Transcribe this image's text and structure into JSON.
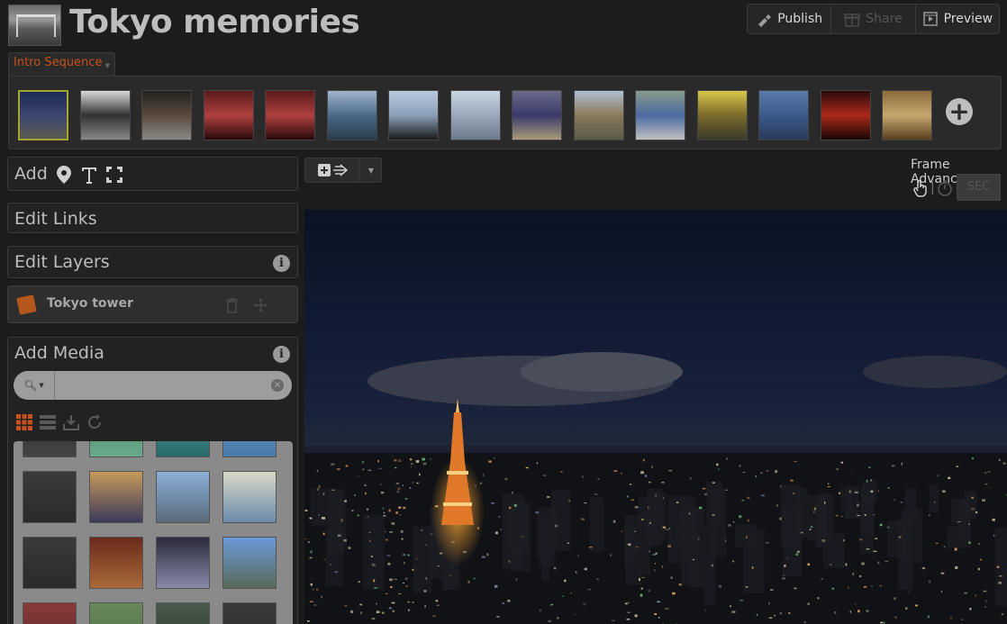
{
  "header": {
    "title": "Tokyo memories",
    "actions": [
      {
        "label": "Publish",
        "icon": "pen-icon",
        "enabled": true
      },
      {
        "label": "Share",
        "icon": "gift-icon",
        "enabled": false
      },
      {
        "label": "Preview",
        "icon": "film-icon",
        "enabled": true
      }
    ]
  },
  "sequence": {
    "tab_label": "Intro Sequence",
    "frames": [
      {
        "id": 1,
        "colors": [
          "#1c2a55",
          "#3a4570",
          "#5a5a50"
        ],
        "selected": true
      },
      {
        "id": 2,
        "colors": [
          "#d8d8d8",
          "#333333",
          "#888888"
        ],
        "selected": false
      },
      {
        "id": 3,
        "colors": [
          "#222222",
          "#5a4a3a",
          "#888888"
        ],
        "selected": false
      },
      {
        "id": 4,
        "colors": [
          "#5a1a1a",
          "#b04040",
          "#2a0a0a"
        ],
        "selected": false
      },
      {
        "id": 5,
        "colors": [
          "#5a1a1a",
          "#b04040",
          "#2a0a0a"
        ],
        "selected": false
      },
      {
        "id": 6,
        "colors": [
          "#a0b4cc",
          "#4a6a8a",
          "#2a3a4a"
        ],
        "selected": false
      },
      {
        "id": 7,
        "colors": [
          "#b8c8dd",
          "#8aa0b8",
          "#1a1a1a"
        ],
        "selected": false
      },
      {
        "id": 8,
        "colors": [
          "#c8d4e0",
          "#9aaabb",
          "#6a7a8a"
        ],
        "selected": false
      },
      {
        "id": 9,
        "colors": [
          "#6a6a8a",
          "#3a3a6a",
          "#aa9a7a"
        ],
        "selected": false
      },
      {
        "id": 10,
        "colors": [
          "#b0c0d0",
          "#8a7a5a",
          "#5a5a4a"
        ],
        "selected": false
      },
      {
        "id": 11,
        "colors": [
          "#8a9a8a",
          "#4a6aa0",
          "#c0c0c0"
        ],
        "selected": false
      },
      {
        "id": 12,
        "colors": [
          "#d8c84a",
          "#7a6a2a",
          "#3a3a2a"
        ],
        "selected": false
      },
      {
        "id": 13,
        "colors": [
          "#5a7aaa",
          "#3a5a8a",
          "#2a3a5a"
        ],
        "selected": false
      },
      {
        "id": 14,
        "colors": [
          "#2a0a0a",
          "#aa2a1a",
          "#1a0505"
        ],
        "selected": false
      },
      {
        "id": 15,
        "colors": [
          "#8a6a3a",
          "#c8a870",
          "#5a4020"
        ],
        "selected": false
      }
    ],
    "add_frame_label": "+"
  },
  "left": {
    "add": {
      "title": "Add",
      "icons": [
        "map-pin-icon",
        "text-icon",
        "frame-select-icon"
      ]
    },
    "links": {
      "title": "Edit Links"
    },
    "layers": {
      "title": "Edit Layers",
      "info": "i"
    },
    "layer_items": [
      {
        "name": "Tokyo tower",
        "icon": "image-layer-icon"
      }
    ],
    "media": {
      "title": "Add Media",
      "info": "i",
      "search_value": "",
      "search_placeholder": "",
      "clear": "×",
      "tools": [
        "grid-view-icon",
        "list-view-icon",
        "import-icon",
        "refresh-icon"
      ],
      "grid": [
        {
          "colors": [
            "#2a2a2a",
            "#444444"
          ]
        },
        {
          "colors": [
            "#4a8a6a",
            "#6aaa8a"
          ]
        },
        {
          "colors": [
            "#4a9a9a",
            "#2a6a6a"
          ]
        },
        {
          "colors": [
            "#6a9ac8",
            "#4a7aa8"
          ]
        },
        {
          "colors": [
            "#3a3a3a",
            "#2a2a2a"
          ]
        },
        {
          "colors": [
            "#c89a5a",
            "#3a3a5a"
          ]
        },
        {
          "colors": [
            "#8ab0d8",
            "#5a6a7a"
          ]
        },
        {
          "colors": [
            "#d8d8c8",
            "#6a8aaa"
          ]
        },
        {
          "colors": [
            "#3a3a3a",
            "#2a2a2a"
          ]
        },
        {
          "colors": [
            "#6a2a1a",
            "#aa6a3a"
          ]
        },
        {
          "colors": [
            "#2a2a3a",
            "#8a8aaa"
          ]
        },
        {
          "colors": [
            "#6a9ad8",
            "#5a6a5a"
          ]
        },
        {
          "colors": [
            "#8a3a3a",
            "#5a2a2a"
          ]
        },
        {
          "colors": [
            "#6a8a5a",
            "#4a6a4a"
          ]
        },
        {
          "colors": [
            "#4a5a4a",
            "#2a3a2a"
          ]
        },
        {
          "colors": [
            "#3a3a3a",
            "#2a2a2a"
          ]
        }
      ]
    }
  },
  "canvas": {
    "frame_advance_label": "Frame Advance",
    "sec_label": "SEC",
    "toolbar_icons": [
      "add-transition-icon",
      "dropdown-caret-icon"
    ]
  }
}
